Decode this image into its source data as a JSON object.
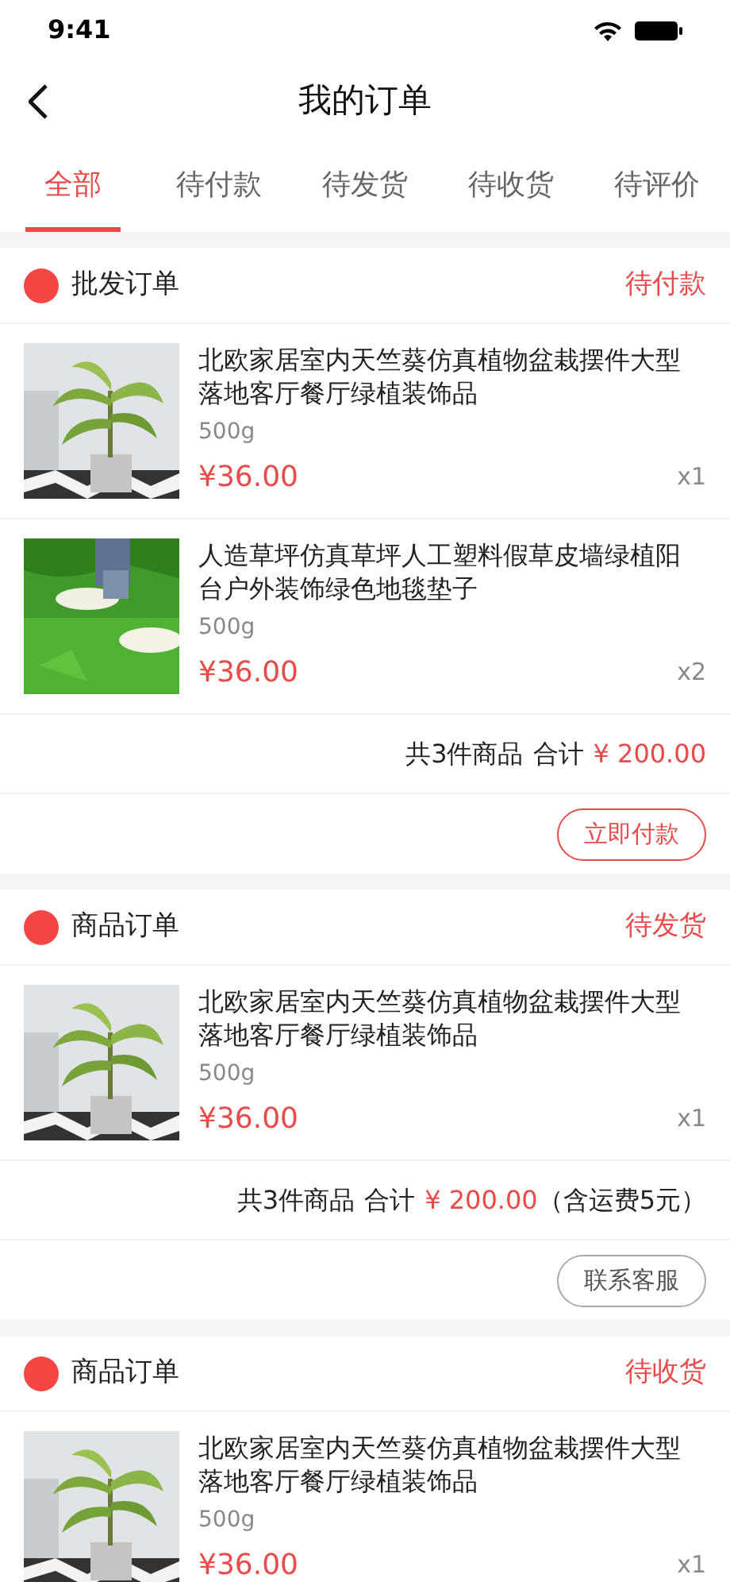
{
  "status_bar": {
    "time": "9:41"
  },
  "nav": {
    "title": "我的订单"
  },
  "tabs": [
    {
      "label": "全部",
      "selected": true
    },
    {
      "label": "待付款",
      "selected": false
    },
    {
      "label": "待发货",
      "selected": false
    },
    {
      "label": "待收货",
      "selected": false
    },
    {
      "label": "待评价",
      "selected": false
    }
  ],
  "orders": [
    {
      "type_label": "批发订单",
      "status": "待付款",
      "items": [
        {
          "title": "北欧家居室内天竺葵仿真植物盆栽摆件大型落地客厅餐厅绿植装饰品",
          "spec": "500g",
          "price": "¥36.00",
          "qty": "x1"
        },
        {
          "title": "人造草坪仿真草坪人工塑料假草皮墙绿植阳台户外装饰绿色地毯垫子",
          "spec": "500g",
          "price": "¥36.00",
          "qty": "x2"
        }
      ],
      "summary": {
        "count": "共3件商品",
        "total_label": "合计",
        "amount": "¥ 200.00"
      },
      "action": {
        "label": "立即付款",
        "kind": "primary"
      }
    },
    {
      "type_label": "商品订单",
      "status": "待发货",
      "items": [
        {
          "title": "北欧家居室内天竺葵仿真植物盆栽摆件大型落地客厅餐厅绿植装饰品",
          "spec": "500g",
          "price": "¥36.00",
          "qty": "x1"
        }
      ],
      "summary": {
        "count": "共3件商品",
        "total_label": "合计",
        "amount": "¥ 200.00",
        "note": "（含运费5元）"
      },
      "action": {
        "label": "联系客服",
        "kind": "secondary"
      }
    },
    {
      "type_label": "商品订单",
      "status": "待收货",
      "items": [
        {
          "title": "北欧家居室内天竺葵仿真植物盆栽摆件大型落地客厅餐厅绿植装饰品",
          "spec": "500g",
          "price": "¥36.00",
          "qty": "x1"
        }
      ]
    }
  ]
}
